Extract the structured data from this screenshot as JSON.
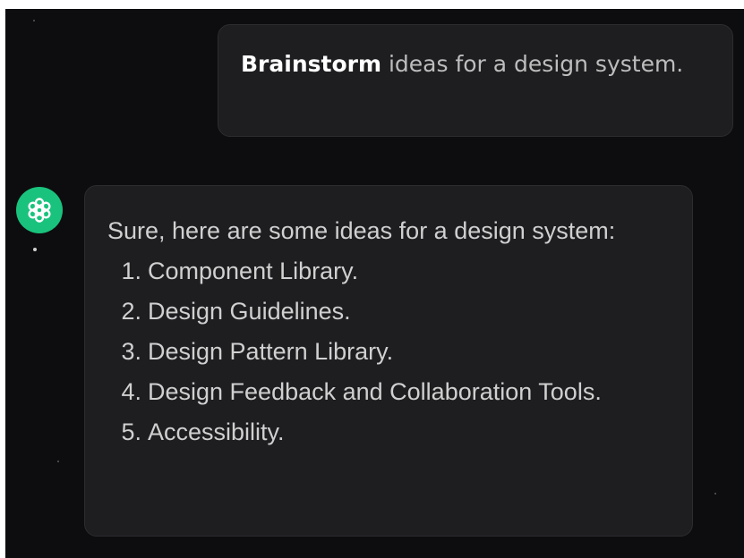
{
  "user_message": {
    "bold_text": "Brainstorm",
    "text": " ideas for a design system."
  },
  "assistant": {
    "avatar_icon": "openai-logo-icon",
    "avatar_color": "#19c37d",
    "intro": "Sure, here are some ideas for a design system:",
    "items": [
      {
        "number": "1.",
        "text": "Component Library."
      },
      {
        "number": "2.",
        "text": "Design Guidelines."
      },
      {
        "number": "3.",
        "text": "Design Pattern Library."
      },
      {
        "number": "4.",
        "text": "Design Feedback and Collaboration Tools."
      },
      {
        "number": "5.",
        "text": "Accessibility."
      }
    ]
  },
  "colors": {
    "background": "#0d0d0f",
    "bubble": "#1e1e21",
    "text_bright": "#ffffff",
    "text_muted": "#bdbdbd"
  }
}
